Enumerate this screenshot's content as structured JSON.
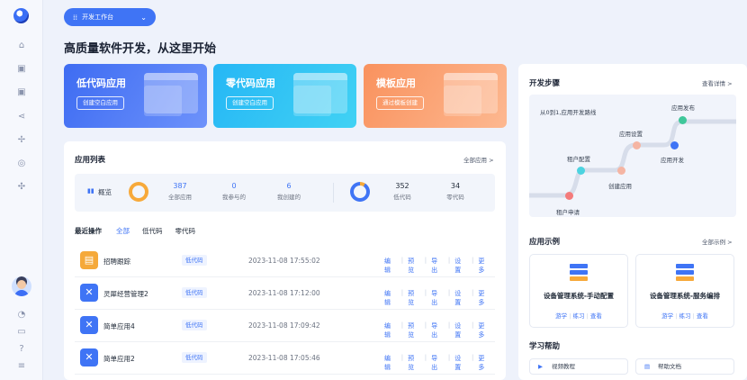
{
  "workspace": {
    "label": "开发工作台"
  },
  "headline": "高质量软件开发，从这里开始",
  "hero": [
    {
      "title": "低代码应用",
      "button": "创建空白应用"
    },
    {
      "title": "零代码应用",
      "button": "创建空白应用"
    },
    {
      "title": "模板应用",
      "button": "通过模板创建"
    }
  ],
  "app_list": {
    "title": "应用列表",
    "all_link": "全部应用 >",
    "overview_label": "概览",
    "stats": [
      {
        "value": "387",
        "label": "全部应用"
      },
      {
        "value": "0",
        "label": "我参与的"
      },
      {
        "value": "6",
        "label": "我创建的"
      },
      {
        "value": "352",
        "label": "低代码"
      },
      {
        "value": "34",
        "label": "零代码"
      }
    ],
    "recent_label": "最近操作",
    "tabs": [
      "全部",
      "低代码",
      "零代码"
    ],
    "rows": [
      {
        "name": "招聘跟踪",
        "tag": "低代码",
        "time": "2023-11-08 17:55:02"
      },
      {
        "name": "灵犀经营管理2",
        "tag": "低代码",
        "time": "2023-11-08 17:12:00"
      },
      {
        "name": "简单应用4",
        "tag": "低代码",
        "time": "2023-11-08 17:09:42"
      },
      {
        "name": "简单应用2",
        "tag": "低代码",
        "time": "2023-11-08 17:05:46"
      }
    ],
    "actions": [
      "编辑",
      "预览",
      "导出",
      "设置",
      "更多"
    ]
  },
  "dev_steps": {
    "title": "开发步骤",
    "link": "查看详情 >",
    "subtitle": "从0到1,应用开发路线",
    "nodes": [
      "租户申请",
      "租户配置",
      "创建应用",
      "应用设置",
      "应用开发",
      "应用发布"
    ]
  },
  "examples": {
    "title": "应用示例",
    "link": "全部示例 >",
    "cards": [
      {
        "name": "设备管理系统-手动配置",
        "links": [
          "游学",
          "练习",
          "查看"
        ]
      },
      {
        "name": "设备管理系统-服务编排",
        "links": [
          "游学",
          "练习",
          "查看"
        ]
      }
    ]
  },
  "help": {
    "title": "学习帮助",
    "items": [
      "视频教程",
      "帮助文档"
    ]
  },
  "colors": {
    "accent": "#3f74f5",
    "orange": "#f7a93a"
  }
}
